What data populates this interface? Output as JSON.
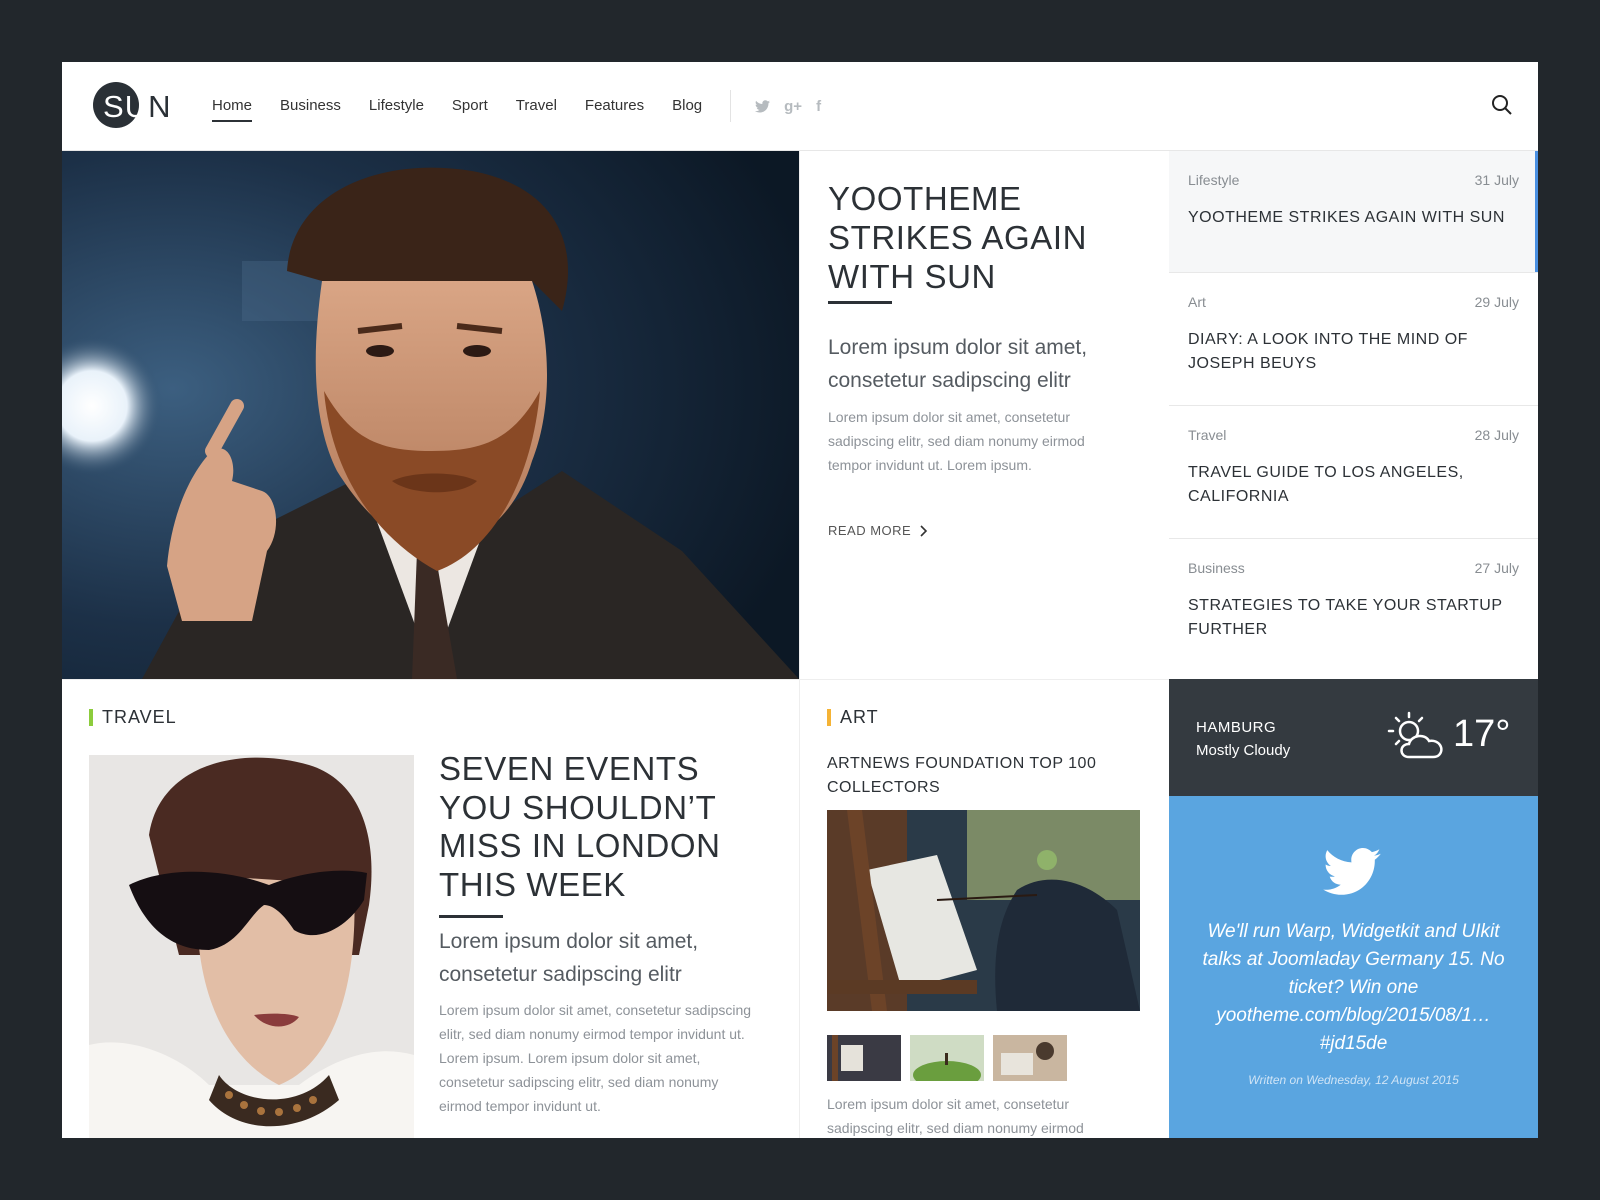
{
  "header": {
    "logo_text": "SUN",
    "nav": [
      "Home",
      "Business",
      "Lifestyle",
      "Sport",
      "Travel",
      "Features",
      "Blog"
    ],
    "social_icons": [
      "twitter-icon",
      "google-plus-icon",
      "facebook-icon"
    ],
    "search_icon": "search-icon"
  },
  "hero": {
    "title": "YOOTHEME STRIKES AGAIN WITH SUN",
    "lead": "Lorem ipsum dolor sit amet, consetetur sadipscing elitr",
    "body": "Lorem ipsum dolor sit amet, consetetur sadipscing elitr, sed diam nonumy eirmod tempor invidunt ut. Lorem ipsum.",
    "read_more": "READ MORE"
  },
  "side_list": [
    {
      "category": "Lifestyle",
      "date": "31 July",
      "title": "YOOTHEME STRIKES AGAIN WITH SUN"
    },
    {
      "category": "Art",
      "date": "29 July",
      "title": "DIARY: A LOOK INTO THE MIND OF JOSEPH BEUYS"
    },
    {
      "category": "Travel",
      "date": "28 July",
      "title": "TRAVEL GUIDE TO LOS ANGELES, CALIFORNIA"
    },
    {
      "category": "Business",
      "date": "27 July",
      "title": "STRATEGIES TO TAKE YOUR STARTUP FURTHER"
    }
  ],
  "travel": {
    "section": "TRAVEL",
    "accent": "#8ccc3c",
    "title": "SEVEN EVENTS YOU SHOULDN’T MISS IN LONDON THIS WEEK",
    "lead": "Lorem ipsum dolor sit amet, consetetur sadipscing elitr",
    "body": "Lorem ipsum dolor sit amet, consetetur sadipscing elitr, sed diam nonumy eirmod tempor invidunt ut. Lorem ipsum. Lorem ipsum dolor sit amet, consetetur sadipscing elitr, sed diam nonumy eirmod tempor invidunt ut."
  },
  "art": {
    "section": "ART",
    "accent": "#f5b335",
    "title": "ARTNEWS FOUNDATION TOP 100 COLLECTORS",
    "body": "Lorem ipsum dolor sit amet, consetetur sadipscing elitr, sed diam nonumy eirmod"
  },
  "weather": {
    "city": "HAMBURG",
    "condition": "Mostly Cloudy",
    "temperature": "17°",
    "icon": "partly-cloudy-icon"
  },
  "twitter": {
    "tweet": "We'll run Warp, Widgetkit and UIkit talks at Joomladay Germany 15. No ticket? Win one yootheme.com/blog/2015/08/1… #jd15de",
    "written": "Written on Wednesday, 12 August 2015",
    "background": "#5aa5e0"
  },
  "colors": {
    "page_bg": "#22272c",
    "accent_blue": "#4a90e2",
    "weather_bg": "#343a40"
  }
}
